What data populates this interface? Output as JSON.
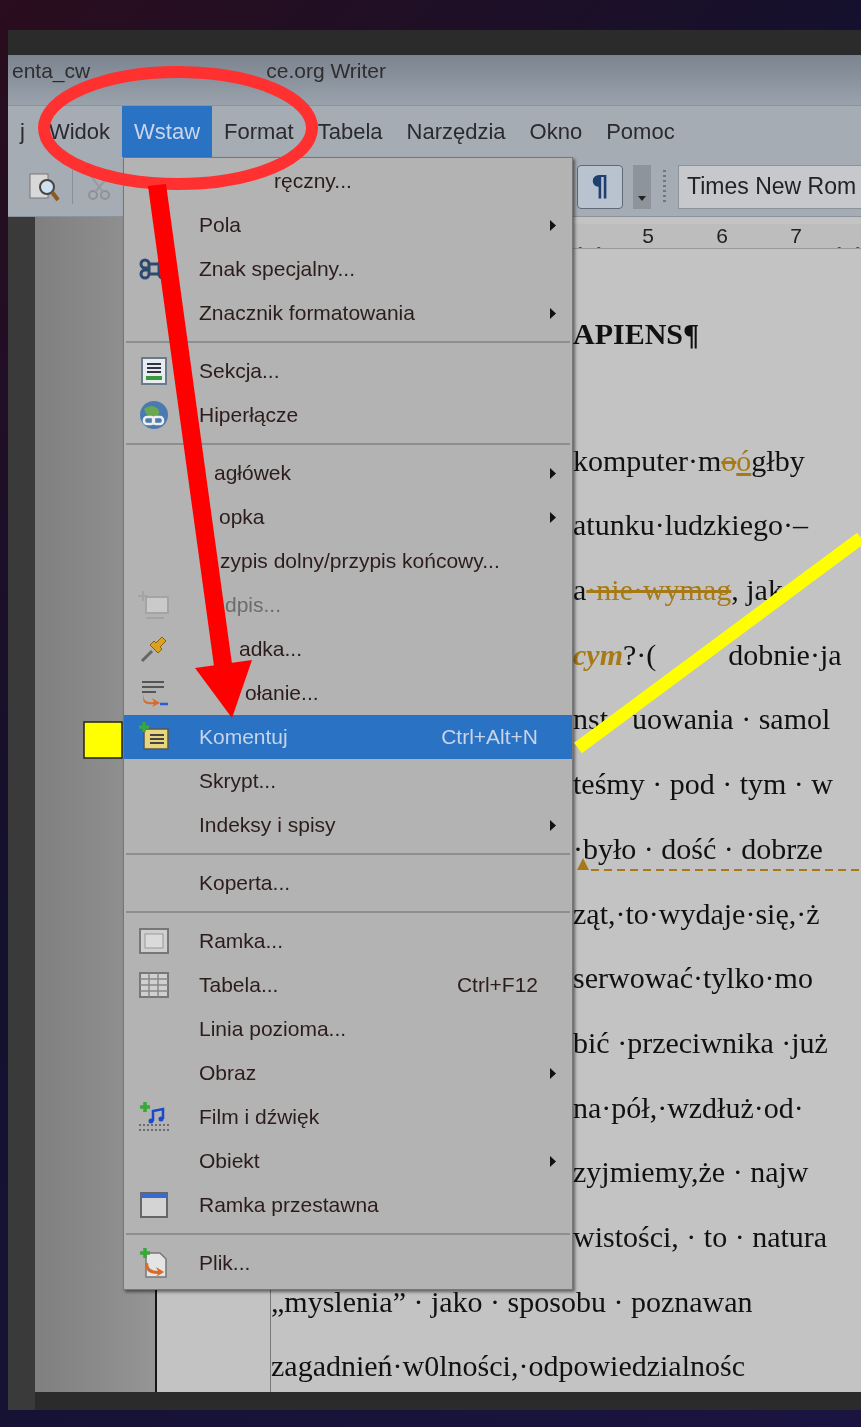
{
  "window": {
    "title_start": "enta_cw",
    "title_end": "ce.org Writer"
  },
  "menubar": [
    {
      "label": "j",
      "selected": false
    },
    {
      "label": "Widok",
      "selected": false
    },
    {
      "label": "Wstaw",
      "selected": true
    },
    {
      "label": "Format",
      "selected": false
    },
    {
      "label": "Tabela",
      "selected": false
    },
    {
      "label": "Narzędzia",
      "selected": false
    },
    {
      "label": "Okno",
      "selected": false
    },
    {
      "label": "Pomoc",
      "selected": false
    }
  ],
  "toolbar": {
    "formatting_marks": {
      "label": "¶",
      "on": true
    },
    "font_name": "Times New Rom"
  },
  "ruler": {
    "labels": [
      "5",
      "6",
      "7"
    ]
  },
  "document": {
    "beside_menu_lines": [
      {
        "marked": false,
        "segments": [
          {
            "kind": "bold",
            "text": "APIENS¶"
          }
        ]
      },
      {
        "marked": false,
        "segments": [
          {
            "kind": "text",
            "text": "komputer·m"
          },
          {
            "kind": "deleted",
            "text": "o"
          },
          {
            "kind": "inserted",
            "text": "ó"
          },
          {
            "kind": "text",
            "text": "głby"
          }
        ]
      },
      {
        "marked": false,
        "segments": [
          {
            "kind": "text",
            "text": "atunku·ludzkiego·–"
          }
        ]
      },
      {
        "marked": false,
        "segments": [
          {
            "kind": "text",
            "text": "a"
          },
          {
            "kind": "deleted",
            "text": "·nie·wymag"
          },
          {
            "kind": "text",
            "text": ", jak"
          }
        ]
      },
      {
        "marked": false,
        "segments": [
          {
            "kind": "inserted-italic",
            "text": "cym"
          },
          {
            "kind": "text",
            "text": "?·("
          },
          {
            "kind": "covered"
          },
          {
            "kind": "text",
            "text": "dobnie·ja"
          }
        ]
      },
      {
        "marked": false,
        "segments": [
          {
            "kind": "text",
            "text": "nst"
          },
          {
            "kind": "covered"
          },
          {
            "kind": "text",
            "text": "uowania · samol"
          }
        ]
      },
      {
        "marked": false,
        "segments": [
          {
            "kind": "text",
            "text": "teśmy · pod · tym · w"
          }
        ]
      },
      {
        "marked": true,
        "segments": [
          {
            "kind": "text",
            "text": "·było · dość · dobrze"
          }
        ]
      },
      {
        "marked": false,
        "segments": [
          {
            "kind": "text",
            "text": "ząt,·to·wydaje·się,·ż"
          }
        ]
      },
      {
        "marked": false,
        "segments": [
          {
            "kind": "text",
            "text": "serwować·tylko·mo"
          }
        ]
      },
      {
        "marked": false,
        "segments": [
          {
            "kind": "text",
            "text": "bić ·przeciwnika ·już"
          }
        ]
      },
      {
        "marked": false,
        "segments": [
          {
            "kind": "text",
            "text": "na·pół,·wzdłuż·od·"
          }
        ]
      },
      {
        "marked": false,
        "segments": [
          {
            "kind": "text",
            "text": "zyjmiemy,że · najw"
          }
        ]
      },
      {
        "marked": false,
        "segments": [
          {
            "kind": "text",
            "text": "wistości, · to · natura"
          }
        ]
      }
    ],
    "lines": [
      {
        "marked": false,
        "segments": [
          {
            "kind": "text",
            "text": "„myslenia” · jako · sposobu · poznawan"
          }
        ]
      },
      {
        "marked": false,
        "segments": [
          {
            "kind": "text",
            "text": "zagadnień·w0lności,·odpowiedzialnośc"
          }
        ]
      }
    ]
  },
  "insert_menu": {
    "items": [
      {
        "kind": "item",
        "label": "ręczny...",
        "submenu": false,
        "disabled": false,
        "selected": false
      },
      {
        "kind": "item",
        "label": "Pola",
        "submenu": true,
        "disabled": false,
        "selected": false
      },
      {
        "kind": "item",
        "label": "Znak specjalny...",
        "submenu": false,
        "disabled": false,
        "selected": false
      },
      {
        "kind": "item",
        "label": "Znacznik formatowania",
        "submenu": true,
        "disabled": false,
        "selected": false
      },
      {
        "kind": "separator"
      },
      {
        "kind": "item",
        "label": "Sekcja...",
        "submenu": false,
        "disabled": false,
        "selected": false
      },
      {
        "kind": "item",
        "label": "Hiperłącze",
        "submenu": false,
        "disabled": false,
        "selected": false
      },
      {
        "kind": "separator"
      },
      {
        "kind": "item",
        "label": "agłówek",
        "submenu": true,
        "disabled": false,
        "selected": false
      },
      {
        "kind": "item",
        "label": "opka",
        "submenu": true,
        "disabled": false,
        "selected": false
      },
      {
        "kind": "item",
        "label": "zypis dolny/przypis końcowy...",
        "submenu": false,
        "disabled": false,
        "selected": false
      },
      {
        "kind": "item",
        "label": "dpis...",
        "submenu": false,
        "disabled": true,
        "selected": false
      },
      {
        "kind": "item",
        "label": "adka...",
        "submenu": false,
        "disabled": false,
        "selected": false
      },
      {
        "kind": "item",
        "label": "ołanie...",
        "submenu": false,
        "disabled": false,
        "selected": false
      },
      {
        "kind": "item",
        "label": "Komentuj",
        "shortcut": "Ctrl+Alt+N",
        "submenu": false,
        "disabled": false,
        "selected": true
      },
      {
        "kind": "item",
        "label": "Skrypt...",
        "submenu": false,
        "disabled": false,
        "selected": false
      },
      {
        "kind": "item",
        "label": "Indeksy i spisy",
        "submenu": true,
        "disabled": false,
        "selected": false
      },
      {
        "kind": "separator"
      },
      {
        "kind": "item",
        "label": "Koperta...",
        "submenu": false,
        "disabled": false,
        "selected": false
      },
      {
        "kind": "separator"
      },
      {
        "kind": "item",
        "label": "Ramka...",
        "submenu": false,
        "disabled": false,
        "selected": false
      },
      {
        "kind": "item",
        "label": "Tabela...",
        "shortcut": "Ctrl+F12",
        "submenu": false,
        "disabled": false,
        "selected": false
      },
      {
        "kind": "item",
        "label": "Linia pozioma...",
        "submenu": false,
        "disabled": false,
        "selected": false
      },
      {
        "kind": "item",
        "label": "Obraz",
        "submenu": true,
        "disabled": false,
        "selected": false
      },
      {
        "kind": "item",
        "label": "Film i dźwięk",
        "submenu": false,
        "disabled": false,
        "selected": false
      },
      {
        "kind": "item",
        "label": "Obiekt",
        "submenu": true,
        "disabled": false,
        "selected": false
      },
      {
        "kind": "item",
        "label": "Ramka przestawna",
        "submenu": false,
        "disabled": false,
        "selected": false
      },
      {
        "kind": "separator"
      },
      {
        "kind": "item",
        "label": "Plik...",
        "submenu": false,
        "disabled": false,
        "selected": false
      }
    ]
  }
}
